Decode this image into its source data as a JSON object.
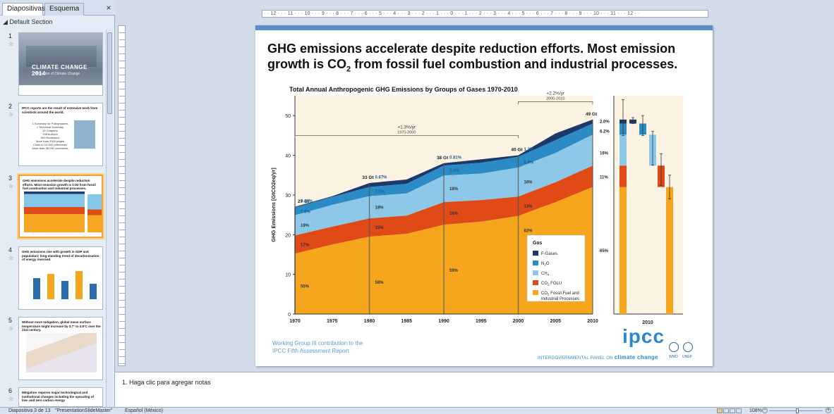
{
  "left_pane": {
    "tabs": [
      "Diapositivas",
      "Esquema"
    ],
    "close_glyph": "×",
    "section": "◢ Default Section",
    "slides": [
      {
        "number": "1",
        "title": "CLIMATE CHANGE 2014",
        "subtitle": "Mitigation of Climate Change"
      },
      {
        "number": "2",
        "title": "IPCC reports are the result of extensive work from scientists around the world.",
        "lines": [
          "1 Summary for Policymakers",
          "1 Technical Summary",
          "16 Chapters",
          "235 Authors",
          "900 Reviewers",
          "More than 2000 pages",
          "Close to 10,000 references",
          "More than 38,000 comments"
        ]
      },
      {
        "number": "3",
        "title": "GHG emissions accelerate despite reduction efforts. Most emission growth is CO2 from fossil fuel combustion and industrial processes."
      },
      {
        "number": "4",
        "title": "GHG emissions rise with growth in GDP and population; long-standing trend of decarbonisation of energy reversed."
      },
      {
        "number": "5",
        "title": "Without more mitigation, global mean surface temperature might increase by 3.7° to 4.8°C over the 21st century."
      },
      {
        "number": "6",
        "title": "Mitigation requires major technological and institutional changes including the upscaling of low- and zero carbon energy"
      }
    ]
  },
  "ruler": {
    "top_ticks": "· · 12 · · · 11 · · · 10 · · · 9 · · · 8 · · · 7 · · · 6 · · · 5 · · · 4 · · · 3 · · · 2 · · · 1 · · · 0 · · · 1 · · · 2 · · · 3 · · · 4 · · · 5 · · · 6 · · · 7 · · · 8 · · · 9 · · · 10 · · · 11 · · · 12 · ·"
  },
  "slide": {
    "title_line1": "GHG emissions accelerate despite reduction efforts. Most emission",
    "title_line2_pre": "growth is CO",
    "title_line2_sub": "2",
    "title_line2_post": " from fossil fuel combustion and industrial processes.",
    "footer_line1": "Working Group III contribution to the",
    "footer_line2": "IPCC Fifth Assessment Report",
    "logo": "ipcc",
    "tagline_pre": "INTERGOVERNMENTAL PANEL ON ",
    "tagline_bold": "climate change",
    "org1": "WMO",
    "org2": "UNEP"
  },
  "chart_data": {
    "type": "area",
    "title": "Total Annual Anthropogenic GHG Emissions by Groups of Gases 1970-2010",
    "ylabel": "GHG Emissions [GtCO2eq/yr]",
    "xlabel": "",
    "xlim": [
      1970,
      2010
    ],
    "ylim": [
      0,
      55
    ],
    "yticks": [
      0,
      10,
      20,
      30,
      40,
      50
    ],
    "xticks": [
      1970,
      1975,
      1980,
      1985,
      1990,
      1995,
      2000,
      2005,
      2010
    ],
    "x": [
      1970,
      1975,
      1980,
      1985,
      1990,
      1995,
      2000,
      2005,
      2010
    ],
    "stack_tops": {
      "CO2 Fossil Fuel and Industrial Processes": [
        15.2,
        17.5,
        19.5,
        20.2,
        22.5,
        23.3,
        24.7,
        28.2,
        32
      ],
      "CO2 FOLU": [
        19.8,
        22.0,
        24.1,
        24.8,
        28.2,
        28.7,
        29.6,
        33.2,
        37.4
      ],
      "CH4": [
        24.9,
        27.5,
        29.7,
        30.4,
        34.9,
        35.4,
        36.9,
        40.6,
        45.2
      ],
      "N2O": [
        26.8,
        29.5,
        32.0,
        32.8,
        37.4,
        38.1,
        39.6,
        43.8,
        48.0
      ],
      "F-Gases": [
        27,
        29.7,
        33,
        33.9,
        38,
        39.0,
        40,
        45.5,
        49
      ]
    },
    "series": [
      {
        "name": "F-Gases",
        "color": "#1b3a6b"
      },
      {
        "name": "N2O",
        "color": "#2b8bc4"
      },
      {
        "name": "CH4",
        "color": "#8ec8e8"
      },
      {
        "name": "CO2 FOLU",
        "color": "#e04a17"
      },
      {
        "name": "CO2 Fossil Fuel and Industrial Processes",
        "color": "#f5a61d"
      }
    ],
    "legend_title": "Gas",
    "legend_labels": [
      {
        "pre": "F-Gases",
        "sub": ""
      },
      {
        "pre": "N",
        "sub": "2",
        "post": "O"
      },
      {
        "pre": "CH",
        "sub": "4",
        "post": ""
      },
      {
        "pre": "CO",
        "sub": "2",
        "post": " FOLU"
      },
      {
        "pre": "CO",
        "sub": "2",
        "post": " Fossil Fuel and",
        "line2": "Industrial Processes"
      }
    ],
    "legend_position": "bottom-right",
    "totals": [
      {
        "year": 1970,
        "label": "27 Gt",
        "value": 27
      },
      {
        "year": 1980,
        "label": "33 Gt",
        "value": 33
      },
      {
        "year": 1990,
        "label": "38 Gt",
        "value": 38
      },
      {
        "year": 2000,
        "label": "40 Gt",
        "value": 40
      },
      {
        "year": 2010,
        "label": "49 Gt",
        "value": 49
      }
    ],
    "annotations": [
      {
        "label": "+1.3%/yr",
        "sub": "1970-2000",
        "from": 1970,
        "to": 2000,
        "y": 45
      },
      {
        "label": "+2.2%/yr",
        "sub": "2000-2010",
        "from": 2000,
        "to": 2010,
        "y": 53.5
      }
    ],
    "share_labels": [
      {
        "year": 1970,
        "values": [
          "55%",
          "17%",
          "19%",
          "7.9%",
          "0.44%"
        ]
      },
      {
        "year": 1980,
        "values": [
          "58%",
          "15%",
          "18%",
          "7.5%",
          "0.67%"
        ]
      },
      {
        "year": 1990,
        "values": [
          "59%",
          "16%",
          "18%",
          "7.4%",
          "0.81%"
        ]
      },
      {
        "year": 2000,
        "values": [
          "62%",
          "13%",
          "16%",
          "6.9%",
          "1.3%"
        ]
      },
      {
        "year": 2010,
        "values": [
          "65%",
          "11%",
          "16%",
          "6.2%",
          "2.0%"
        ]
      }
    ],
    "panel_2010": {
      "xlabel": "2010",
      "stack": [
        32,
        5.4,
        7.8,
        2.8,
        1
      ],
      "ranges": [
        {
          "series": "total",
          "value": 49,
          "low": 45,
          "high": 54
        },
        {
          "series": "F-Gases",
          "value": 49,
          "low": 48,
          "high": 49.5
        },
        {
          "series": "N2O",
          "value": 48,
          "low": 45,
          "high": 50
        },
        {
          "series": "CH4",
          "value": 45.2,
          "low": 37.5,
          "high": 46
        },
        {
          "series": "CO2 FOLU",
          "value": 37.4,
          "low": 32.4,
          "high": 40.4
        },
        {
          "series": "CO2 Fossil Fuel and Industrial Processes",
          "value": 32,
          "low": 29,
          "high": 35
        }
      ]
    }
  },
  "notes": {
    "placeholder": "1.  Haga clic para agregar notas"
  },
  "status": {
    "slide": "Diapositiva 3 de 13",
    "theme": "\"PresentationSlideMaster\"",
    "language": "Español (México)",
    "zoom": "108%",
    "zoom_minus": "−",
    "zoom_plus": "+"
  }
}
